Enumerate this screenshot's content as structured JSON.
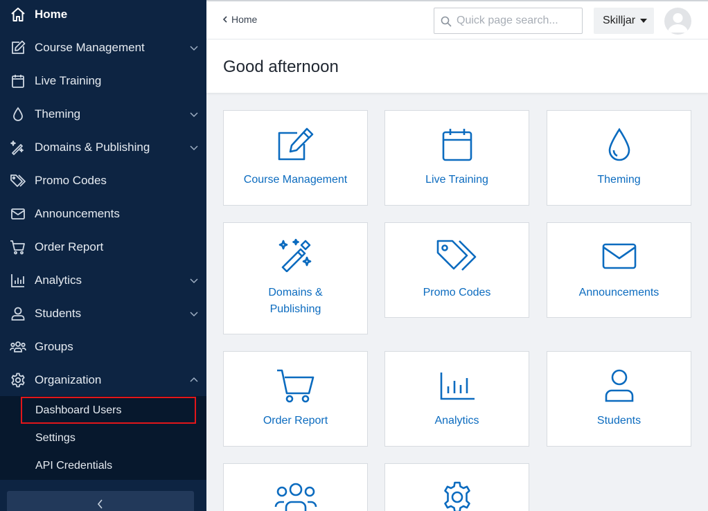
{
  "sidebar": {
    "items": [
      {
        "label": "Home",
        "icon": "home-icon"
      },
      {
        "label": "Course Management",
        "icon": "edit-icon"
      },
      {
        "label": "Live Training",
        "icon": "calendar-icon"
      },
      {
        "label": "Theming",
        "icon": "droplet-icon"
      },
      {
        "label": "Domains & Publishing",
        "icon": "magic-wand-icon"
      },
      {
        "label": "Promo Codes",
        "icon": "tag-icon"
      },
      {
        "label": "Announcements",
        "icon": "envelope-icon"
      },
      {
        "label": "Order Report",
        "icon": "cart-icon"
      },
      {
        "label": "Analytics",
        "icon": "bar-chart-icon"
      },
      {
        "label": "Students",
        "icon": "user-icon"
      },
      {
        "label": "Groups",
        "icon": "users-icon"
      },
      {
        "label": "Organization",
        "icon": "gear-icon"
      }
    ],
    "submenu": [
      "Dashboard Users",
      "Settings",
      "API Credentials"
    ]
  },
  "topbar": {
    "breadcrumb": "Home",
    "search_placeholder": "Quick page search...",
    "org_name": "Skilljar"
  },
  "header": {
    "greeting": "Good afternoon"
  },
  "tiles": [
    {
      "label": "Course Management",
      "icon": "edit-icon"
    },
    {
      "label": "Live Training",
      "icon": "calendar-icon"
    },
    {
      "label": "Theming",
      "icon": "droplet-icon"
    },
    {
      "label": "Domains & Publishing",
      "icon": "magic-wand-icon"
    },
    {
      "label": "Promo Codes",
      "icon": "tag-icon"
    },
    {
      "label": "Announcements",
      "icon": "envelope-icon"
    },
    {
      "label": "Order Report",
      "icon": "cart-icon"
    },
    {
      "label": "Analytics",
      "icon": "bar-chart-icon"
    },
    {
      "label": "Students",
      "icon": "user-icon"
    },
    {
      "label": "Groups",
      "icon": "users-icon"
    },
    {
      "label": "Organization",
      "icon": "gear-icon"
    }
  ],
  "colors": {
    "sidebar_bg": "#0d2442",
    "submenu_bg": "#07182d",
    "accent_blue": "#0b6bbf",
    "highlight_red": "#e3161a"
  }
}
